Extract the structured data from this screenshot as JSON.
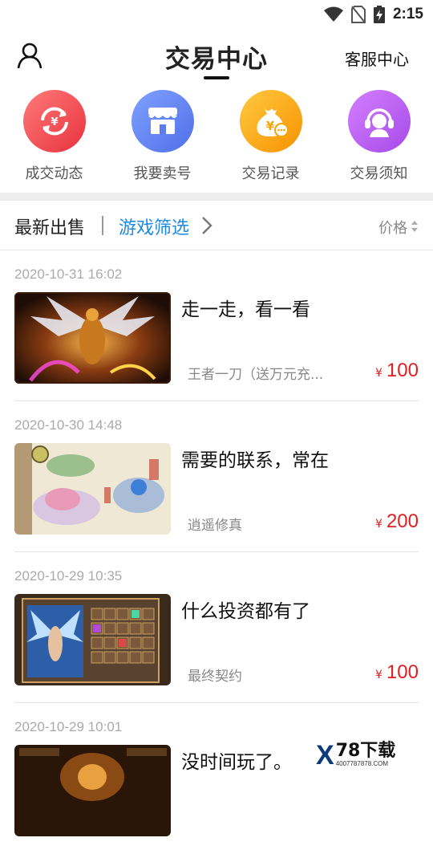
{
  "status": {
    "time": "2:15"
  },
  "header": {
    "title": "交易中心",
    "service": "客服中心"
  },
  "quick_actions": [
    {
      "label": "成交动态",
      "icon": "exchange-icon",
      "color": "#f0474f"
    },
    {
      "label": "我要卖号",
      "icon": "store-icon",
      "color": "#5a7ef0"
    },
    {
      "label": "交易记录",
      "icon": "money-bag-icon",
      "color": "#f7a300"
    },
    {
      "label": "交易须知",
      "icon": "customer-service-icon",
      "color": "#b05ef0"
    }
  ],
  "filter": {
    "latest": "最新出售",
    "game_filter": "游戏筛选",
    "price": "价格"
  },
  "listings": [
    {
      "date": "2020-10-31 16:02",
      "title": "走一走，看一看",
      "game": "王者一刀（送万元充...",
      "currency": "¥",
      "price": "100"
    },
    {
      "date": "2020-10-30 14:48",
      "title": "需要的联系，常在",
      "game": "逍遥修真",
      "currency": "¥",
      "price": "200"
    },
    {
      "date": "2020-10-29 10:35",
      "title": "什么投资都有了",
      "game": "最终契约",
      "currency": "¥",
      "price": "100"
    },
    {
      "date": "2020-10-29 10:01",
      "title": "没时间玩了。",
      "game": "",
      "currency": "",
      "price": ""
    }
  ],
  "watermark": {
    "brand": "X",
    "text": "78下载",
    "phone": "4007787878.COM"
  }
}
